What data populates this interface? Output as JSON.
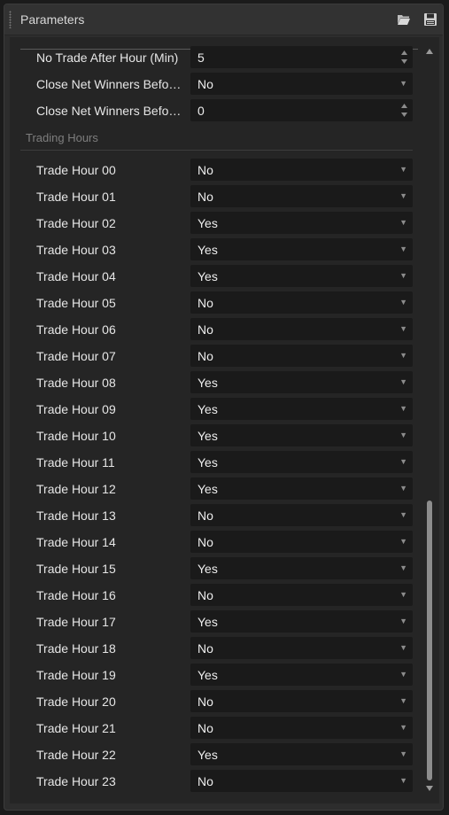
{
  "panel": {
    "title": "Parameters",
    "open_icon": "folder-open-icon",
    "save_icon": "save-icon"
  },
  "top_params": [
    {
      "label": "No Trade After Hour (Min)",
      "value": "5",
      "control": "spinner"
    },
    {
      "label": "Close Net Winners Befo…",
      "value": "No",
      "control": "dropdown"
    },
    {
      "label": "Close Net Winners Befo…",
      "value": "0",
      "control": "spinner"
    }
  ],
  "section": {
    "title": "Trading Hours"
  },
  "trade_hours": [
    {
      "label": "Trade Hour 00",
      "value": "No"
    },
    {
      "label": "Trade Hour 01",
      "value": "No"
    },
    {
      "label": "Trade Hour 02",
      "value": "Yes"
    },
    {
      "label": "Trade Hour 03",
      "value": "Yes"
    },
    {
      "label": "Trade Hour 04",
      "value": "Yes"
    },
    {
      "label": "Trade Hour 05",
      "value": "No"
    },
    {
      "label": "Trade Hour 06",
      "value": "No"
    },
    {
      "label": "Trade Hour 07",
      "value": "No"
    },
    {
      "label": "Trade Hour 08",
      "value": "Yes"
    },
    {
      "label": "Trade Hour 09",
      "value": "Yes"
    },
    {
      "label": "Trade Hour 10",
      "value": "Yes"
    },
    {
      "label": "Trade Hour 11",
      "value": "Yes"
    },
    {
      "label": "Trade Hour 12",
      "value": "Yes"
    },
    {
      "label": "Trade Hour 13",
      "value": "No"
    },
    {
      "label": "Trade Hour 14",
      "value": "No"
    },
    {
      "label": "Trade Hour 15",
      "value": "Yes"
    },
    {
      "label": "Trade Hour 16",
      "value": "No"
    },
    {
      "label": "Trade Hour 17",
      "value": "Yes"
    },
    {
      "label": "Trade Hour 18",
      "value": "No"
    },
    {
      "label": "Trade Hour 19",
      "value": "Yes"
    },
    {
      "label": "Trade Hour 20",
      "value": "No"
    },
    {
      "label": "Trade Hour 21",
      "value": "No"
    },
    {
      "label": "Trade Hour 22",
      "value": "Yes"
    },
    {
      "label": "Trade Hour 23",
      "value": "No"
    }
  ],
  "icons": {
    "dropdown_arrow": "▼",
    "scroll_up": "▲",
    "scroll_down": "▼"
  }
}
